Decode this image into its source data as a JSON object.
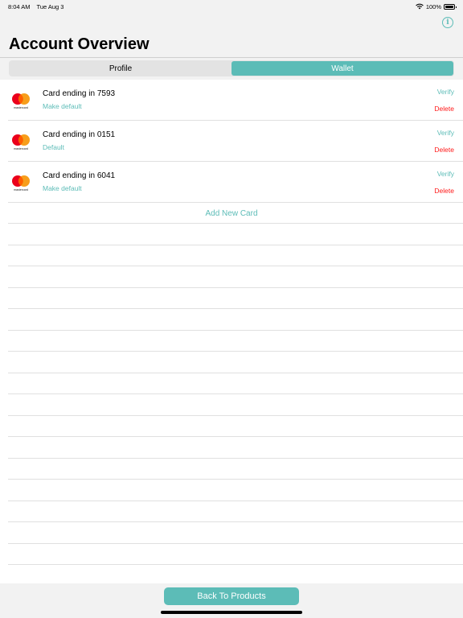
{
  "status_bar": {
    "time": "8:04 AM",
    "date": "Tue Aug 3",
    "battery": "100%",
    "icons": [
      "wifi-icon",
      "battery-icon"
    ]
  },
  "header": {
    "title": "Account Overview",
    "info_icon": "info-icon"
  },
  "segments": [
    {
      "label": "Profile",
      "active": false
    },
    {
      "label": "Wallet",
      "active": true
    }
  ],
  "cards": [
    {
      "title": "Card ending in 7593",
      "status": "Make default",
      "verify": "Verify",
      "delete": "Delete",
      "brand": "mastercard"
    },
    {
      "title": "Card ending in 0151",
      "status": "Default",
      "verify": "Verify",
      "delete": "Delete",
      "brand": "mastercard"
    },
    {
      "title": "Card ending in 6041",
      "status": "Make default",
      "verify": "Verify",
      "delete": "Delete",
      "brand": "mastercard"
    }
  ],
  "add_card_label": "Add New Card",
  "footer": {
    "back_label": "Back To Products"
  },
  "colors": {
    "accent": "#5cbcb7",
    "danger": "#ff1a1a",
    "background": "#f2f2f2",
    "mastercard_red": "#eb001b",
    "mastercard_orange": "#f79e1b"
  }
}
